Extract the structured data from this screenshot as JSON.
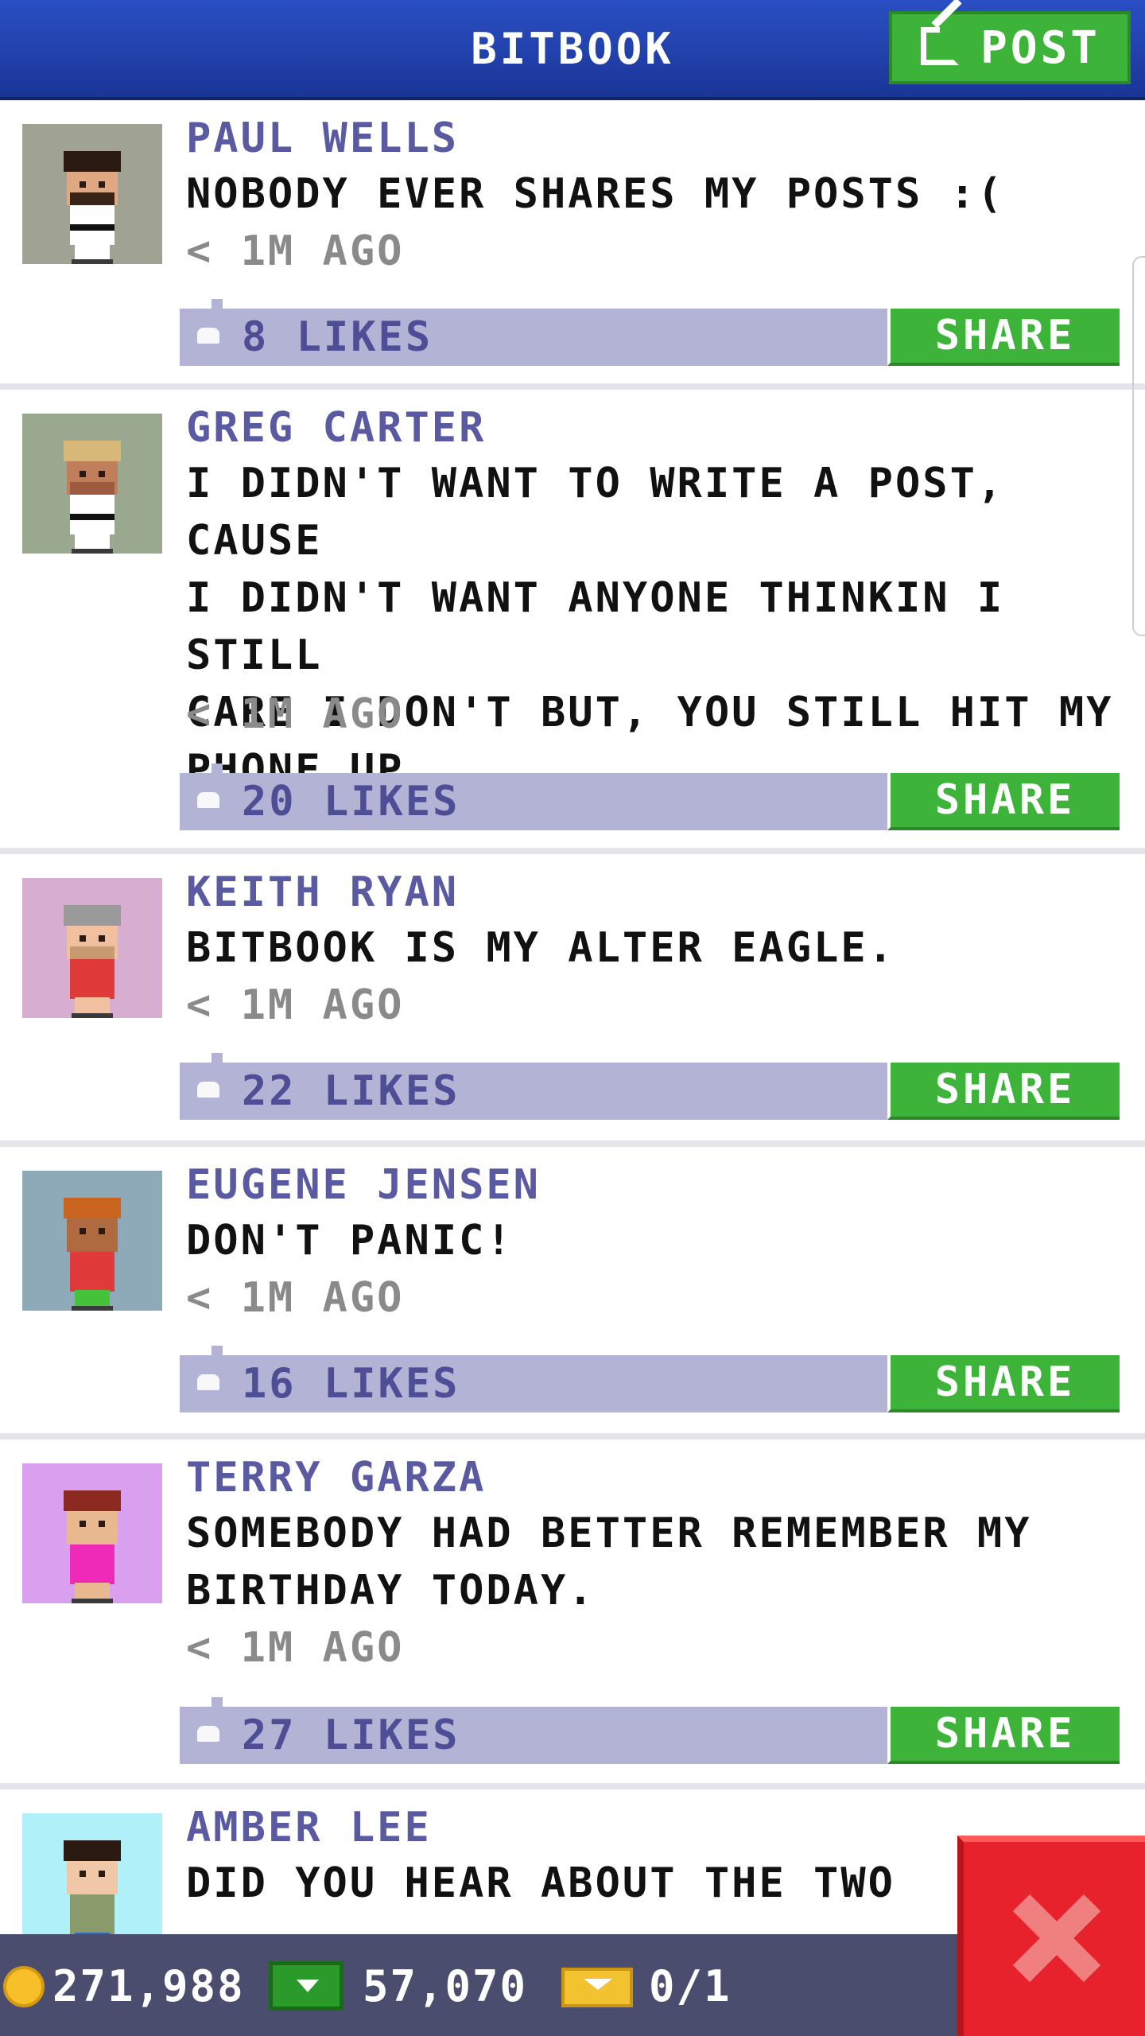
{
  "header": {
    "title": "BITBOOK",
    "post_label": "POST"
  },
  "posts": [
    {
      "name": "PAUL WELLS",
      "text": "NOBODY EVER SHARES MY POSTS :(",
      "time": "< 1M AGO",
      "likes": "8 LIKES",
      "share_label": "SHARE",
      "avatar": {
        "bg": "#a0a294",
        "hair": "#2a1a12",
        "headband": "#ffffff",
        "skin": "#e0a882",
        "beard": "#3a2418",
        "body": "#ffffff",
        "legs": "#ffffff",
        "belt": true
      }
    },
    {
      "name": "GREG CARTER",
      "text": "I DIDN'T WANT TO WRITE A POST, CAUSE\nI DIDN'T WANT ANYONE THINKIN I STILL\nCARE I DON'T BUT, YOU STILL HIT MY\nPHONE UP.",
      "time": "< 1M AGO",
      "likes": "20 LIKES",
      "share_label": "SHARE",
      "avatar": {
        "bg": "#9aa890",
        "hair": "#d8b878",
        "headband": "#ffffff",
        "skin": "#c07e5a",
        "beard": "#a05a40",
        "body": "#ffffff",
        "legs": "#ffffff",
        "belt": true
      }
    },
    {
      "name": "KEITH RYAN",
      "text": "BITBOOK IS MY ALTER EAGLE.",
      "time": "< 1M AGO",
      "likes": "22 LIKES",
      "share_label": "SHARE",
      "avatar": {
        "bg": "#d8aed0",
        "hair": "#9a9a9a",
        "headband": "#b8b8b8",
        "skin": "#f0c0a0",
        "beard": "#c89a70",
        "body": "#e03a3a",
        "legs": "#f0c0a0",
        "belt": false
      }
    },
    {
      "name": "EUGENE JENSEN",
      "text": "DON'T PANIC!",
      "time": "< 1M AGO",
      "likes": "16 LIKES",
      "share_label": "SHARE",
      "avatar": {
        "bg": "#8eaab8",
        "hair": "#c8641e",
        "headband": "#c8641e",
        "skin": "#b06a40",
        "beard": "#b06a40",
        "body": "#e03a3a",
        "legs": "#46c23a",
        "belt": false
      }
    },
    {
      "name": "TERRY GARZA",
      "text": "SOMEBODY HAD BETTER REMEMBER MY\nBIRTHDAY TODAY.",
      "time": "< 1M AGO",
      "likes": "27 LIKES",
      "share_label": "SHARE",
      "avatar": {
        "bg": "#d9a0f0",
        "hair": "#8a2a20",
        "headband": "#8a2a20",
        "skin": "#e8b890",
        "beard": "#e8b890",
        "body": "#f02ab8",
        "legs": "#e8b890",
        "belt": false
      }
    },
    {
      "name": "AMBER LEE",
      "text": "DID YOU HEAR ABOUT THE TWO",
      "time": "",
      "likes": "",
      "share_label": "",
      "avatar": {
        "bg": "#b0f0f8",
        "hair": "#2a1a12",
        "headband": "#2a1a12",
        "skin": "#f0c8a8",
        "beard": "#f0c8a8",
        "body": "#8a9a6a",
        "legs": "#2a6ac8",
        "belt": false
      }
    }
  ],
  "footer": {
    "coins": "271,988",
    "bux": "57,070",
    "tickets": "0/1"
  },
  "colors": {
    "accent_green": "#3db33a",
    "header_blue": "#2a4fc4",
    "like_bar": "#b3b3d6",
    "close_red": "#e8222c"
  }
}
